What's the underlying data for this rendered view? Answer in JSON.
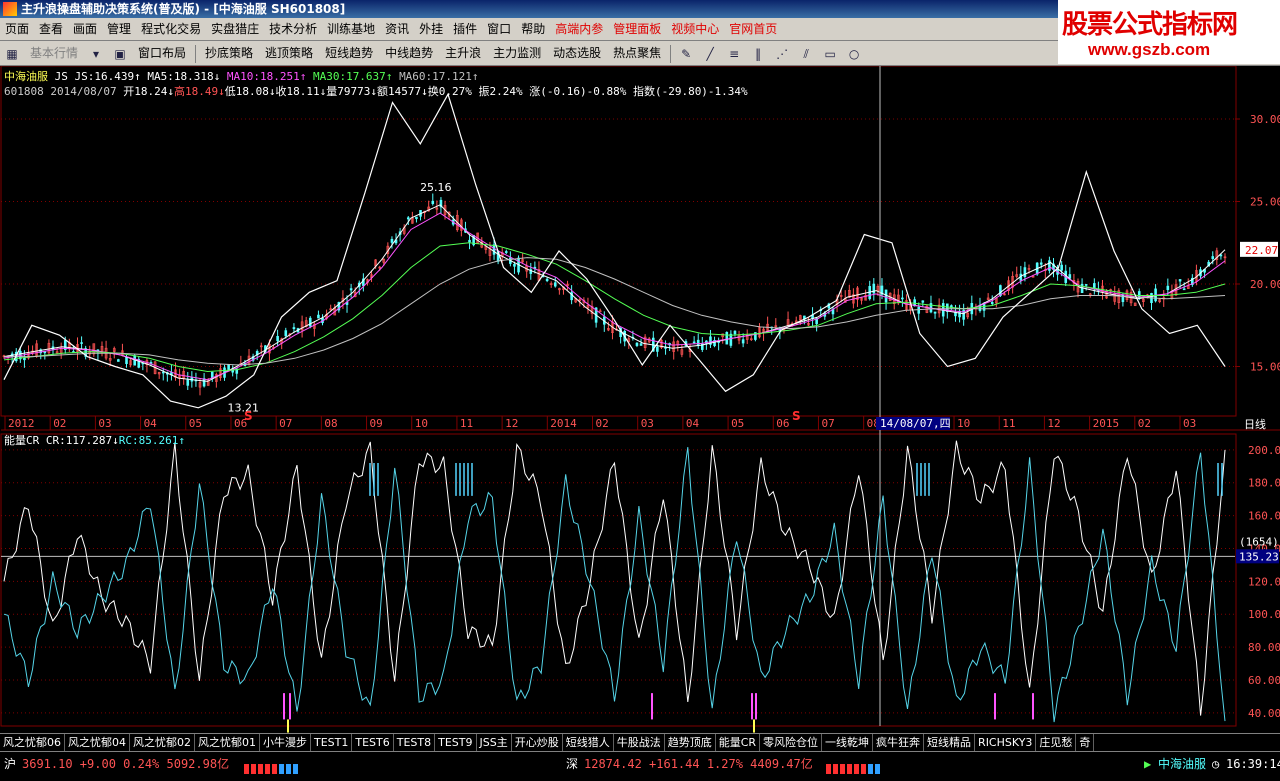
{
  "window": {
    "title": "主升浪操盘辅助决策系统(普及版) - [中海油服 SH601808]"
  },
  "menu": {
    "items": [
      "页面",
      "查看",
      "画面",
      "管理",
      "程式化交易",
      "实盘猎庄",
      "技术分析",
      "训练基地",
      "资讯",
      "外挂",
      "插件",
      "窗口",
      "帮助"
    ],
    "red_items": [
      "高端内参",
      "管理面板",
      "视频中心",
      "官网首页"
    ]
  },
  "toolbar": {
    "items": [
      "基本行情",
      "窗口布局",
      "抄底策略",
      "逃顶策略",
      "短线趋势",
      "中线趋势",
      "主升浪",
      "主力监测",
      "动态选股",
      "热点聚焦"
    ]
  },
  "logo": {
    "line1": "股票公式指标网",
    "line2": "www.gszb.com"
  },
  "info": {
    "stock": "中海油服",
    "js": "JS",
    "js_val": "JS:16.439",
    "ma5": "MA5:18.318",
    "ma10": "MA10:18.251",
    "ma30": "MA30:17.637",
    "ma60": "MA60:17.121",
    "code": "601808",
    "date": "2014/08/07",
    "open": "开18.24",
    "high": "高18.49",
    "low": "低18.08",
    "close": "收18.11",
    "vol": "量79773",
    "amt": "额14577",
    "turnover": "换0.27%",
    "amplitude": "振2.24%",
    "change": "涨(-0.16)-0.88%",
    "index": "指数(-29.80)-1.34%"
  },
  "indicator": {
    "name": "能量CR",
    "cr": "CR:117.287",
    "rc": "RC:85.261"
  },
  "chart_data": [
    {
      "type": "line",
      "title": "",
      "series": [
        {
          "name": "MA5",
          "values": [
            15.6,
            15.9,
            16.2,
            16.0,
            15.7,
            15.1,
            14.3,
            14.1,
            15.0,
            16.0,
            17.1,
            18.0,
            19.5,
            21.5,
            24.0,
            24.8,
            23.0,
            21.8,
            20.9,
            20.2,
            18.6,
            17.3,
            16.4,
            16.1,
            16.3,
            16.7,
            17.0,
            17.5,
            18.0,
            19.2,
            19.6,
            18.8,
            18.5,
            18.2,
            19.1,
            20.5,
            21.3,
            19.8,
            19.4,
            19.1,
            19.4,
            20.4,
            22.07
          ]
        },
        {
          "name": "MA10",
          "values": [
            15.5,
            15.8,
            16.1,
            16.0,
            15.7,
            15.2,
            14.5,
            14.2,
            14.9,
            15.8,
            16.9,
            17.8,
            19.2,
            21.0,
            23.3,
            24.3,
            23.1,
            22.0,
            21.1,
            20.4,
            18.9,
            17.6,
            16.7,
            16.3,
            16.4,
            16.7,
            17.0,
            17.4,
            17.9,
            19.0,
            19.4,
            18.8,
            18.5,
            18.3,
            19.0,
            20.2,
            21.0,
            19.9,
            19.5,
            19.2,
            19.4,
            20.1,
            21.4
          ]
        },
        {
          "name": "MA30",
          "values": [
            15.4,
            15.6,
            15.8,
            15.9,
            15.8,
            15.5,
            15.0,
            14.7,
            14.8,
            15.2,
            15.9,
            16.8,
            17.9,
            19.3,
            21.0,
            22.3,
            22.5,
            22.3,
            21.8,
            21.2,
            20.2,
            19.1,
            18.1,
            17.4,
            17.0,
            16.9,
            17.0,
            17.2,
            17.5,
            18.2,
            18.8,
            18.9,
            18.7,
            18.5,
            18.7,
            19.3,
            20.0,
            19.9,
            19.6,
            19.3,
            19.3,
            19.5,
            20.0
          ]
        },
        {
          "name": "MA60",
          "values": [
            15.6,
            15.6,
            15.7,
            15.8,
            15.8,
            15.7,
            15.4,
            15.2,
            15.1,
            15.2,
            15.5,
            16.0,
            16.7,
            17.6,
            18.8,
            20.0,
            20.9,
            21.4,
            21.6,
            21.5,
            21.0,
            20.3,
            19.5,
            18.7,
            18.1,
            17.7,
            17.4,
            17.3,
            17.4,
            17.7,
            18.1,
            18.4,
            18.5,
            18.5,
            18.5,
            18.7,
            19.1,
            19.3,
            19.3,
            19.2,
            19.1,
            19.2,
            19.3
          ]
        },
        {
          "name": "JS",
          "values": [
            14.2,
            17.5,
            16.9,
            15.6,
            15.0,
            14.5,
            12.9,
            12.5,
            13.2,
            14.5,
            18.0,
            19.5,
            20.2,
            25.5,
            31.0,
            28.5,
            31.5,
            26.0,
            21.0,
            19.5,
            22.0,
            20.3,
            17.8,
            15.1,
            17.5,
            15.5,
            13.5,
            14.5,
            17.2,
            18.0,
            19.0,
            23.0,
            22.5,
            17.0,
            15.0,
            15.5,
            18.0,
            19.5,
            21.0,
            26.8,
            22.0,
            18.5,
            17.0,
            17.5,
            15.0
          ]
        }
      ],
      "annotations": [
        "25.16",
        "13.21"
      ],
      "x_ticks": [
        "2012",
        "02",
        "03",
        "04",
        "05",
        "06",
        "07",
        "08",
        "09",
        "10",
        "11",
        "12",
        "2014",
        "02",
        "03",
        "04",
        "05",
        "06",
        "07",
        "08",
        "09",
        "10",
        "11",
        "12",
        "2015",
        "02",
        "03"
      ],
      "cursor_label": "14/08/07,四",
      "period": "日线",
      "y_ticks": [
        "30.00",
        "25.00",
        "20.00",
        "15.00"
      ],
      "ylim": [
        12,
        32
      ],
      "price_tag": "22.07",
      "markers": [
        "S",
        "S"
      ]
    },
    {
      "type": "line",
      "title": "",
      "series": [
        {
          "name": "CR",
          "values": [
            120,
            168,
            90,
            150,
            110,
            95,
            70,
            200,
            60,
            175,
            185,
            110,
            190,
            70,
            170,
            200,
            60,
            195,
            190,
            90,
            80,
            200,
            170,
            65,
            120,
            195,
            80,
            175,
            45,
            200,
            90,
            190,
            150,
            130,
            95,
            190,
            70,
            200,
            100,
            200,
            170,
            190,
            50,
            200,
            160,
            100,
            200,
            120,
            190,
            40,
            200
          ]
        },
        {
          "name": "RC",
          "values": [
            100,
            60,
            120,
            90,
            110,
            130,
            170,
            50,
            180,
            70,
            60,
            120,
            40,
            170,
            80,
            40,
            190,
            50,
            60,
            160,
            170,
            45,
            70,
            180,
            120,
            50,
            160,
            70,
            200,
            40,
            150,
            60,
            90,
            110,
            150,
            60,
            170,
            40,
            140,
            45,
            80,
            60,
            190,
            40,
            90,
            150,
            50,
            130,
            80,
            200,
            35
          ]
        }
      ],
      "y_ticks": [
        "200.00",
        "180.00",
        "160.00",
        "140.00",
        "120.00",
        "100.00",
        "80.00",
        "60.00",
        "40.00"
      ],
      "ylim": [
        32,
        206
      ],
      "cursor_value": "135.23",
      "count_label": "(1654)"
    }
  ],
  "tabs": [
    "风之忧郁06",
    "风之忧郁04",
    "风之忧郁02",
    "风之忧郁01",
    "小牛漫步",
    "TEST1",
    "TEST6",
    "TEST8",
    "TEST9",
    "JSS主",
    "开心炒股",
    "短线猎人",
    "牛股战法",
    "趋势顶底",
    "能量CR",
    "零风险仓位",
    "一线乾坤",
    "疯牛狂奔",
    "短线精品",
    "RICHSKY3",
    "庄见愁",
    "奇"
  ],
  "status": {
    "sh_label": "沪",
    "sh_values": "3691.10 +9.00 0.24% 5092.98亿",
    "sz_label": "深",
    "sz_values": "12874.42 +161.44 1.27% 4409.47亿",
    "stock": "中海油服",
    "time": "16:39:14"
  },
  "colors": {
    "bg": "#000000",
    "grid": "#800000",
    "up": "#ff5454",
    "down": "#54ffff",
    "ma5": "#ffffff",
    "ma10": "#ff54ff",
    "ma30": "#54ff54",
    "ma60": "#c0c0c0",
    "js": "#ffffff",
    "cr": "#ffffff",
    "rc": "#55d4e8"
  }
}
